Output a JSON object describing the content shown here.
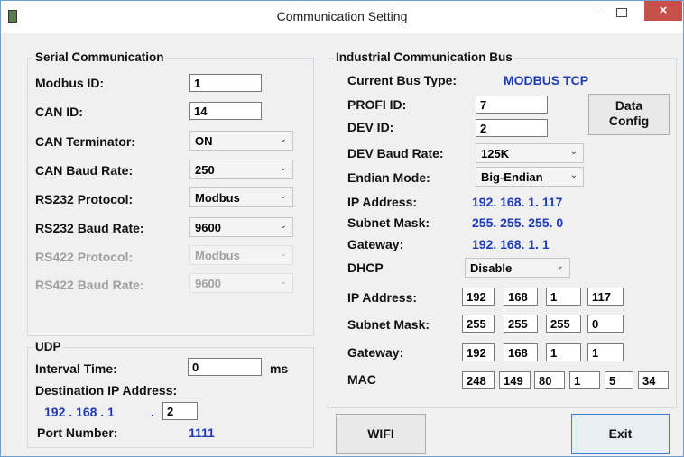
{
  "window": {
    "title": "Communication Setting",
    "minimize": "–",
    "close": "×"
  },
  "serial": {
    "title": "Serial Communication",
    "modbus_id_label": "Modbus ID:",
    "modbus_id": "1",
    "can_id_label": "CAN ID:",
    "can_id": "14",
    "can_term_label": "CAN Terminator:",
    "can_term": "ON",
    "can_baud_label": "CAN Baud Rate:",
    "can_baud": "250",
    "rs232_proto_label": "RS232 Protocol:",
    "rs232_proto": "Modbus",
    "rs232_baud_label": "RS232 Baud Rate:",
    "rs232_baud": "9600",
    "rs422_proto_label": "RS422 Protocol:",
    "rs422_proto": "Modbus",
    "rs422_baud_label": "RS422 Baud Rate:",
    "rs422_baud": "9600"
  },
  "udp": {
    "title": "UDP",
    "interval_label": "Interval Time:",
    "interval": "0",
    "unit": "ms",
    "dest_label": "Destination IP Address:",
    "dest_prefix": "192 . 168 . 1",
    "dot": ".",
    "dest_last": "2",
    "port_label": "Port Number:",
    "port": "1111"
  },
  "industrial": {
    "title": "Industrial Communication Bus",
    "bus_type_label": "Current Bus Type:",
    "bus_type": "MODBUS TCP",
    "profi_label": "PROFI ID:",
    "profi_id": "7",
    "dev_label": "DEV ID:",
    "dev_id": "2",
    "data_config_line1": "Data",
    "data_config_line2": "Config",
    "dev_baud_label": "DEV Baud Rate:",
    "dev_baud": "125K",
    "endian_label": "Endian Mode:",
    "endian": "Big-Endian",
    "ip_label": "IP Address:",
    "ip": "192. 168. 1. 117",
    "subnet_label": "Subnet Mask:",
    "subnet": "255. 255. 255. 0",
    "gateway_label": "Gateway:",
    "gateway": "192. 168. 1. 1",
    "dhcp_label": "DHCP",
    "dhcp": "Disable",
    "ip_edit_label": "IP Address:",
    "ip_fields": [
      "192",
      "168",
      "1",
      "117"
    ],
    "subnet_edit_label": "Subnet Mask:",
    "subnet_fields": [
      "255",
      "255",
      "255",
      "0"
    ],
    "gateway_edit_label": "Gateway:",
    "gateway_fields": [
      "192",
      "168",
      "1",
      "1"
    ],
    "mac_label": "MAC",
    "mac_fields": [
      "248",
      "149",
      "80",
      "1",
      "5",
      "34"
    ]
  },
  "buttons": {
    "wifi": "WIFI",
    "exit": "Exit"
  }
}
